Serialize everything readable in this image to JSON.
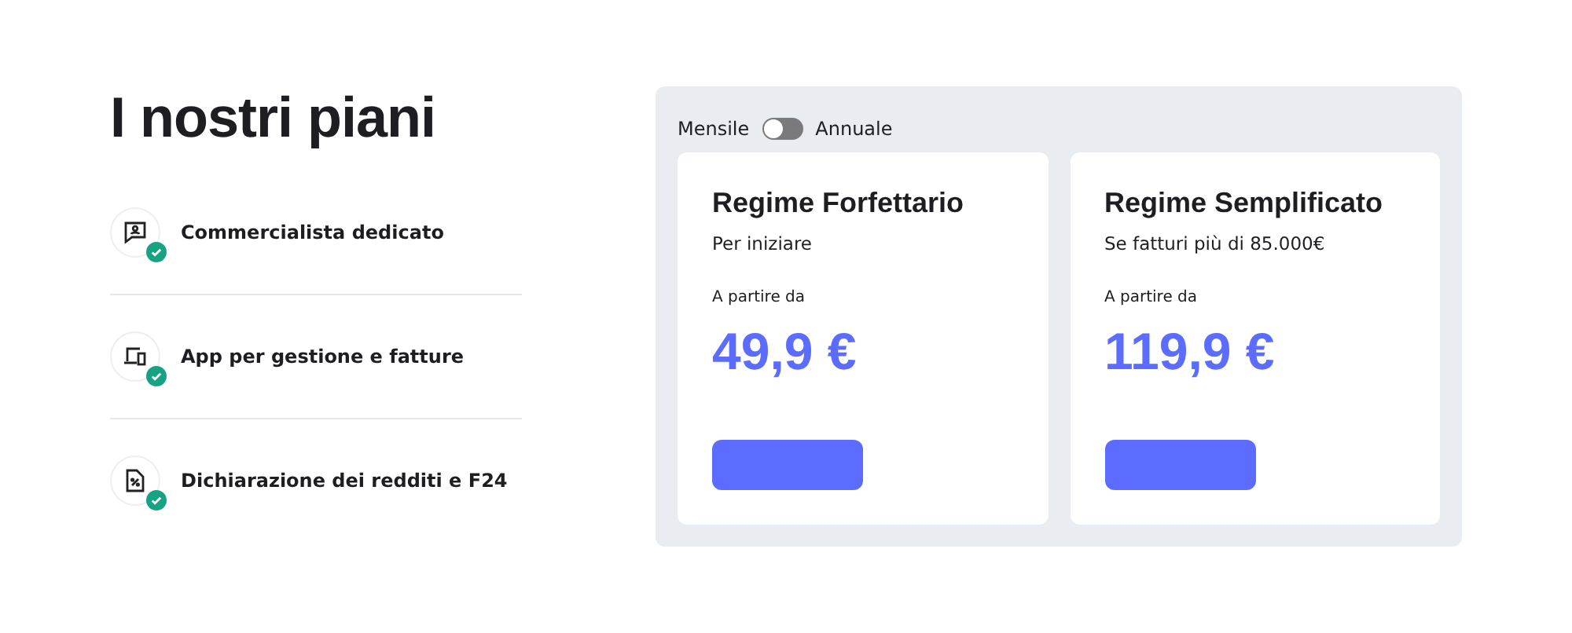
{
  "title": "I nostri piani",
  "features": [
    {
      "label": "Commercialista dedicato",
      "kind": "advisor",
      "checked": true
    },
    {
      "label": "App per gestione e fatture",
      "kind": "devices",
      "checked": true
    },
    {
      "label": "Dichiarazione dei redditi e F24",
      "kind": "tax",
      "checked": true
    }
  ],
  "billing": {
    "left_label": "Mensile",
    "right_label": "Annuale",
    "on": false
  },
  "plans": [
    {
      "name": "Regime Forfettario",
      "subtitle": "Per iniziare",
      "price_label": "A partire da",
      "price": "49,9 €"
    },
    {
      "name": "Regime Semplificato",
      "subtitle": "Se fatturi più di 85.000€",
      "price_label": "A partire da",
      "price": "119,9 €"
    }
  ]
}
